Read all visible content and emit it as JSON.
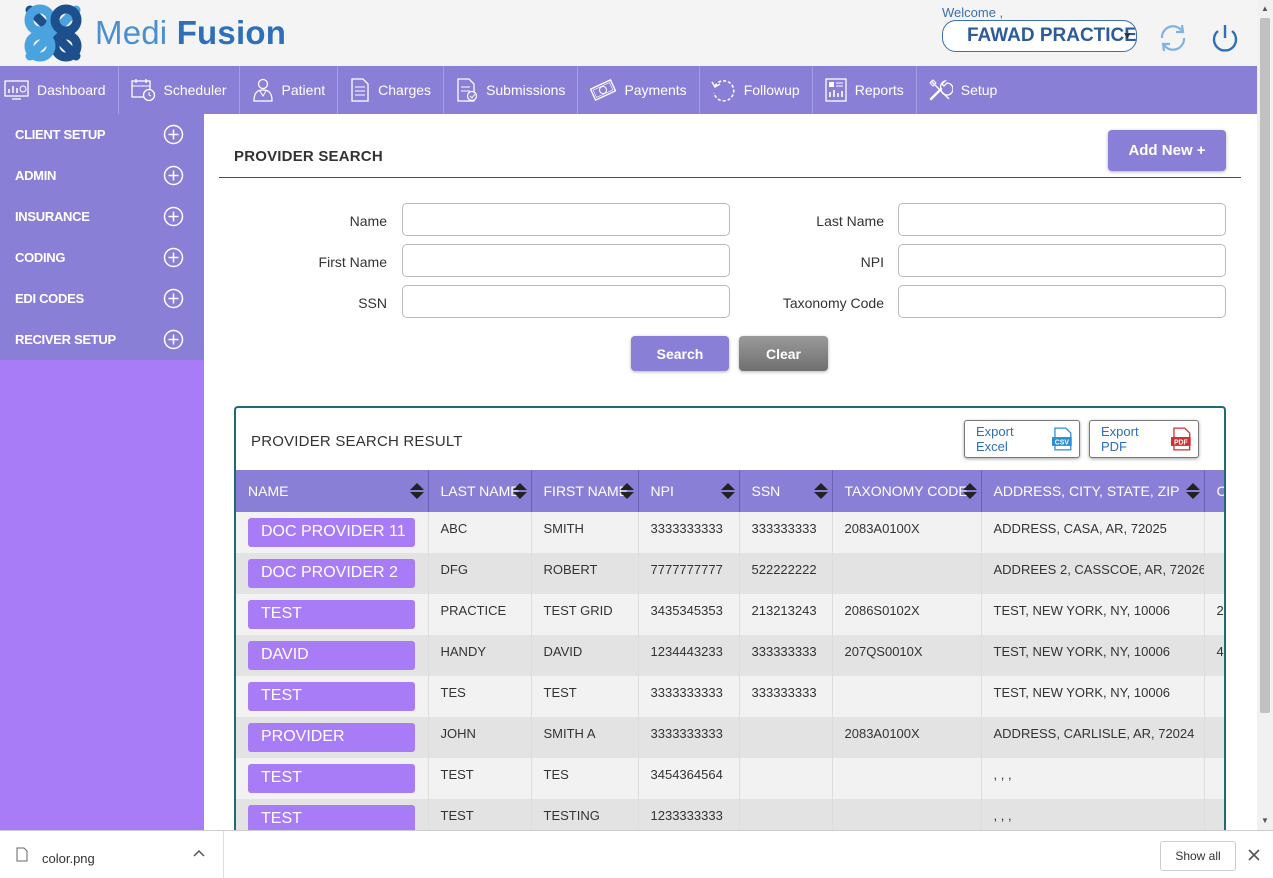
{
  "brand": {
    "first": "Medi",
    "second": "Fusion"
  },
  "header": {
    "welcome": "Welcome ,",
    "practice": "FAWAD PRACTICE",
    "caret": "▾"
  },
  "nav": [
    {
      "label": "Dashboard",
      "icon": "dashboard-icon"
    },
    {
      "label": "Scheduler",
      "icon": "calendar-icon"
    },
    {
      "label": "Patient",
      "icon": "patient-icon"
    },
    {
      "label": "Charges",
      "icon": "document-icon"
    },
    {
      "label": "Submissions",
      "icon": "submission-icon"
    },
    {
      "label": "Payments",
      "icon": "money-icon"
    },
    {
      "label": "Followup",
      "icon": "followup-icon"
    },
    {
      "label": "Reports",
      "icon": "report-icon"
    },
    {
      "label": "Setup",
      "icon": "tools-icon"
    }
  ],
  "sidebar": [
    {
      "label": "CLIENT SETUP"
    },
    {
      "label": "ADMIN"
    },
    {
      "label": "INSURANCE"
    },
    {
      "label": "CODING"
    },
    {
      "label": "EDI CODES"
    },
    {
      "label": "RECIVER SETUP"
    }
  ],
  "page": {
    "title": "PROVIDER SEARCH",
    "add_new": "Add New +"
  },
  "form": {
    "name": {
      "label": "Name",
      "value": ""
    },
    "last_name": {
      "label": "Last Name",
      "value": ""
    },
    "first_name": {
      "label": "First Name",
      "value": ""
    },
    "npi": {
      "label": "NPI",
      "value": ""
    },
    "ssn": {
      "label": "SSN",
      "value": ""
    },
    "taxonomy": {
      "label": "Taxonomy Code",
      "value": ""
    },
    "search": "Search",
    "clear": "Clear"
  },
  "results": {
    "title": "PROVIDER SEARCH RESULT",
    "export_excel": "Export Excel",
    "export_pdf": "Export PDF",
    "columns": [
      "NAME",
      "LAST NAME",
      "FIRST NAME",
      "NPI",
      "SSN",
      "TAXONOMY CODE",
      "ADDRESS, CITY, STATE, ZIP",
      "C"
    ],
    "rows": [
      {
        "name": "DOC PROVIDER 11",
        "last": "ABC",
        "first": "SMITH",
        "npi": "3333333333",
        "ssn": "333333333",
        "taxonomy": "2083A0100X",
        "address": "ADDRESS, CASA, AR, 72025",
        "extra": ""
      },
      {
        "name": "DOC PROVIDER 2",
        "last": "DFG",
        "first": "ROBERT",
        "npi": "7777777777",
        "ssn": "522222222",
        "taxonomy": "",
        "address": "ADDREES 2, CASSCOE, AR, 72026",
        "extra": ""
      },
      {
        "name": "TEST",
        "last": "PRACTICE",
        "first": "TEST GRID",
        "npi": "3435345353",
        "ssn": "213213243",
        "taxonomy": "2086S0102X",
        "address": "TEST, NEW YORK, NY, 10006",
        "extra": "2"
      },
      {
        "name": "DAVID",
        "last": "HANDY",
        "first": "DAVID",
        "npi": "1234443233",
        "ssn": "333333333",
        "taxonomy": "207QS0010X",
        "address": "TEST, NEW YORK, NY, 10006",
        "extra": "4"
      },
      {
        "name": "TEST",
        "last": "TES",
        "first": "TEST",
        "npi": "3333333333",
        "ssn": "333333333",
        "taxonomy": "",
        "address": "TEST, NEW YORK, NY, 10006",
        "extra": ""
      },
      {
        "name": "PROVIDER",
        "last": "JOHN",
        "first": "SMITH A",
        "npi": "3333333333",
        "ssn": "",
        "taxonomy": "2083A0100X",
        "address": "ADDRESS, CARLISLE, AR, 72024",
        "extra": ""
      },
      {
        "name": "TEST",
        "last": "TEST",
        "first": "TES",
        "npi": "3454364564",
        "ssn": "",
        "taxonomy": "",
        "address": ", , ,",
        "extra": ""
      },
      {
        "name": "TEST",
        "last": "TEST",
        "first": "TESTING",
        "npi": "1233333333",
        "ssn": "",
        "taxonomy": "",
        "address": ", , ,",
        "extra": ""
      }
    ]
  },
  "downloads": {
    "file": "color.png",
    "show_all": "Show all"
  },
  "colors": {
    "nav": "#8a7fd6",
    "sidebar_bg": "#a87cf7",
    "pill": "#a87cf7",
    "brand_blue": "#2d6fb8",
    "teal_border": "#1e6b75"
  }
}
